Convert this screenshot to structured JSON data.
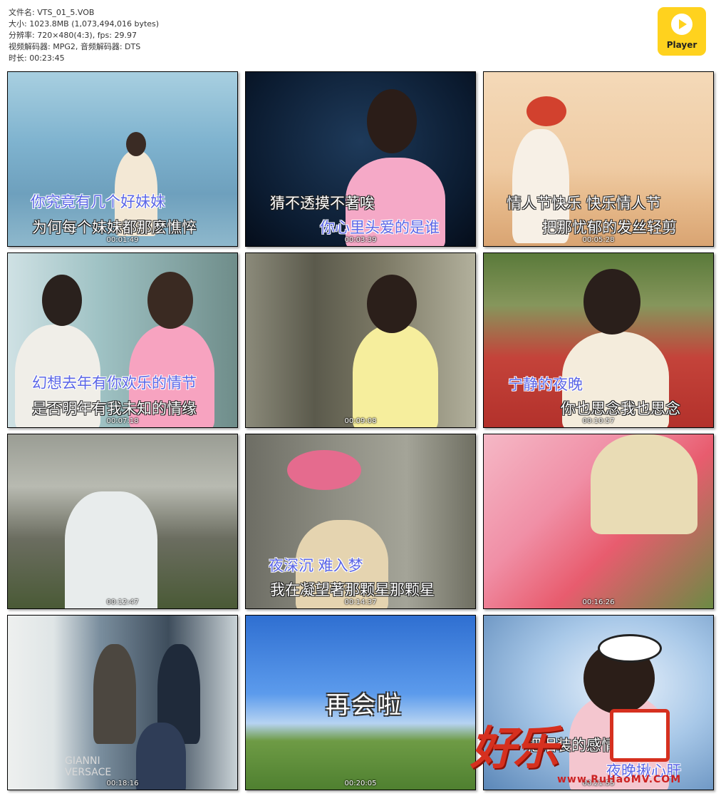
{
  "file_info": {
    "filename": "文件名: VTS_01_5.VOB",
    "size": "大小: 1023.8MB (1,073,494,016 bytes)",
    "resolution": "分辨率: 720×480(4:3), fps: 29.97",
    "codecs": "视频解码器: MPG2, 音频解码器: DTS",
    "duration": "时长: 00:23:45"
  },
  "player_logo": {
    "label": "Player",
    "icon": "play-circle-icon",
    "color": "#FFD21E"
  },
  "thumbnails": [
    {
      "timestamp": "00:01:49",
      "lines": [
        "你究竟有几个好妹妹",
        "为何每个妹妹都那麽憔悴"
      ]
    },
    {
      "timestamp": "00:03:39",
      "lines": [
        "猜不透摸不著唉",
        "你心里头爱的是谁"
      ]
    },
    {
      "timestamp": "00:05:28",
      "lines": [
        "情人节快乐 快乐情人节",
        "把那忧郁的发丝轻剪"
      ]
    },
    {
      "timestamp": "00:07:18",
      "lines": [
        "幻想去年有你欢乐的情节",
        "是否明年有我未知的情缘"
      ]
    },
    {
      "timestamp": "00:09:08",
      "lines": []
    },
    {
      "timestamp": "00:10:57",
      "lines": [
        "宁静的夜晚",
        "你也思念我也思念"
      ]
    },
    {
      "timestamp": "00:12:47",
      "lines": []
    },
    {
      "timestamp": "00:14:37",
      "lines": [
        "夜深沉 难入梦",
        "我在凝望著那颗星那颗星"
      ]
    },
    {
      "timestamp": "00:16:26",
      "lines": []
    },
    {
      "timestamp": "00:18:16",
      "lines": [],
      "sign": "GIANNI VERSACE"
    },
    {
      "timestamp": "00:20:05",
      "lines": [
        "再会啦"
      ]
    },
    {
      "timestamp": "00:21:55",
      "lines": [
        "把泪装的感情",
        "夜晚揪心肝"
      ]
    }
  ],
  "watermark": {
    "text": "好乐",
    "url": "www.RuHaoMV.COM"
  },
  "colors": {
    "lyric_highlight": "#5b66e6",
    "logo_bg": "#FFD21E",
    "watermark": "#d6301f"
  }
}
